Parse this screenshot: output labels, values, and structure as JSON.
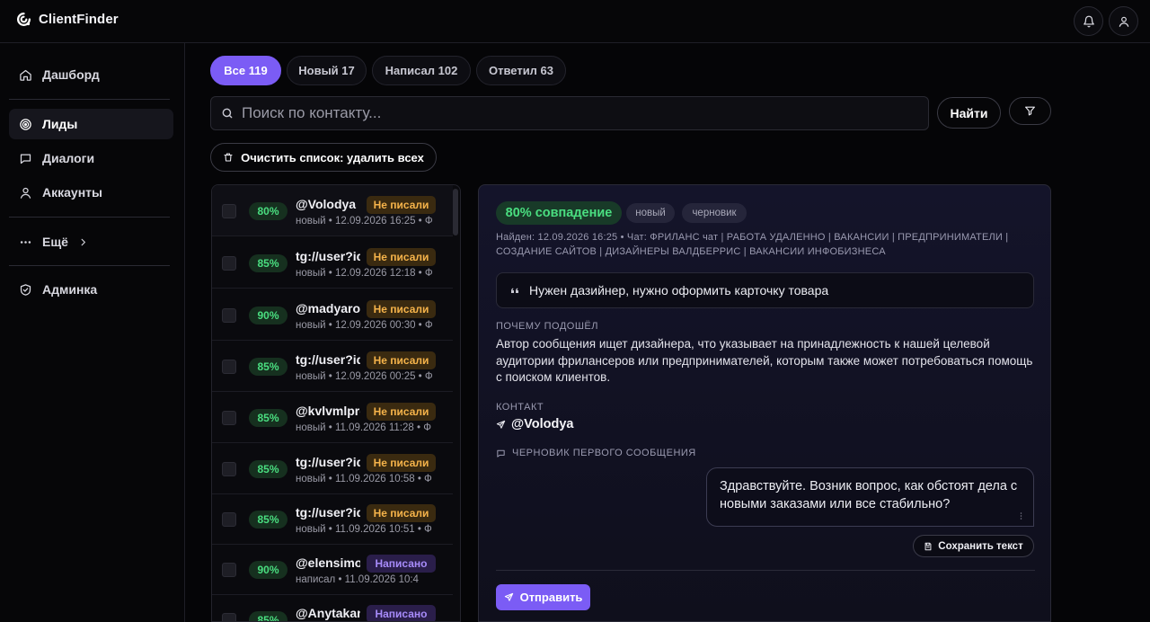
{
  "app": {
    "brand_name": "ClientFinder",
    "accent_color": "#7b5cf5"
  },
  "header": {
    "icons": [
      "bell-icon",
      "user-icon"
    ]
  },
  "sidebar": {
    "items": [
      {
        "label": "Дашборд",
        "icon": "home-icon",
        "active": false
      },
      {
        "label": "Лиды",
        "icon": "target-icon",
        "active": true
      },
      {
        "label": "Диалоги",
        "icon": "chat-icon",
        "active": false
      },
      {
        "label": "Аккаунты",
        "icon": "user-icon",
        "active": false
      },
      {
        "label": "Ещё",
        "icon": "more-icon",
        "active": false
      },
      {
        "label": "Админка",
        "icon": "shield-icon",
        "active": false
      }
    ]
  },
  "filters": {
    "tabs": [
      {
        "label": "Все 119",
        "active": true
      },
      {
        "label": "Новый 17",
        "active": false
      },
      {
        "label": "Написал 102",
        "active": false
      },
      {
        "label": "Ответил 63",
        "active": false
      }
    ]
  },
  "search": {
    "placeholder": "Поиск по контакту...",
    "value": "",
    "find_label": "Найти"
  },
  "actions": {
    "clear_label": "Очистить список: удалить всех"
  },
  "leads": [
    {
      "score": "80%",
      "name": "@Volodya",
      "status": "Не писали",
      "status_type": "unwritten",
      "meta": "новый • 12.09.2026 16:25 • Ф"
    },
    {
      "score": "85%",
      "name": "tg://user?id",
      "status": "Не писали",
      "status_type": "unwritten",
      "meta": "новый • 12.09.2026 12:18 • Ф"
    },
    {
      "score": "90%",
      "name": "@madyarov",
      "status": "Не писали",
      "status_type": "unwritten",
      "meta": "новый • 12.09.2026 00:30 • Ф"
    },
    {
      "score": "85%",
      "name": "tg://user?id",
      "status": "Не писали",
      "status_type": "unwritten",
      "meta": "новый • 12.09.2026 00:25 • Ф"
    },
    {
      "score": "85%",
      "name": "@kvlvmlpro",
      "status": "Не писали",
      "status_type": "unwritten",
      "meta": "новый • 11.09.2026 11:28 • Ф"
    },
    {
      "score": "85%",
      "name": "tg://user?id",
      "status": "Не писали",
      "status_type": "unwritten",
      "meta": "новый • 11.09.2026 10:58 • Ф"
    },
    {
      "score": "85%",
      "name": "tg://user?id",
      "status": "Не писали",
      "status_type": "unwritten",
      "meta": "новый • 11.09.2026 10:51 • Ф"
    },
    {
      "score": "90%",
      "name": "@elensimo",
      "status": "Написано",
      "status_type": "written",
      "meta": "написал • 11.09.2026 10:4"
    },
    {
      "score": "85%",
      "name": "@Anytakana",
      "status": "Написано",
      "status_type": "written",
      "meta": ""
    }
  ],
  "detail": {
    "match": "80% совпадение",
    "tags": [
      "новый",
      "черновик"
    ],
    "found_line": "Найден: 12.09.2026 16:25 • Чат: ФРИЛАНС чат | РАБОТА УДАЛЕННО | ВАКАНСИИ | ПРЕДПРИНИМАТЕЛИ | СОЗДАНИЕ САЙТОВ | ДИЗАЙНЕРЫ ВАЛДБЕРРИС | ВАКАНСИИ ИНФОБИЗНЕСА",
    "quote": "Нужен дазийнер, нужно оформить карточку товара",
    "reason_label": "ПОЧЕМУ ПОДОШЁЛ",
    "reason": "Автор сообщения ищет дизайнера, что указывает на принадлежность к нашей целевой аудитории фрилансеров или предпринимателей, которым также может потребоваться помощь с поиском клиентов.",
    "contact_label": "КОНТАКТ",
    "contact": "@Volodya",
    "draft_label": "ЧЕРНОВИК ПЕРВОГО СООБЩЕНИЯ",
    "draft_text": "Здравствуйте. Возник вопрос, как обстоят дела с новыми заказами или все стабильно?",
    "save_label": "Сохранить текст",
    "send_label": "Отправить"
  }
}
